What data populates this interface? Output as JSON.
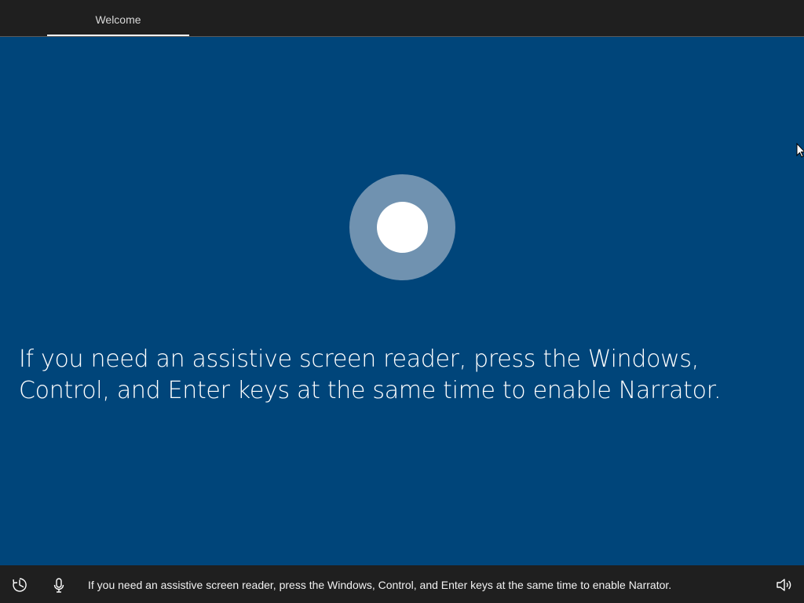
{
  "header": {
    "tab_label": "Welcome"
  },
  "main": {
    "message": "If you need an assistive screen reader, press the Windows, Control, and Enter keys at the same time to enable Narrator."
  },
  "footer": {
    "caption": "If you need an assistive screen reader, press the Windows, Control, and Enter keys at the same time to enable Narrator.",
    "icons": [
      "ease-of-access-icon",
      "microphone-icon",
      "volume-icon"
    ]
  },
  "colors": {
    "background": "#00457a",
    "bar": "#1f1f1f",
    "cortana_ring": "#7092b0",
    "cortana_core": "#ffffff"
  }
}
